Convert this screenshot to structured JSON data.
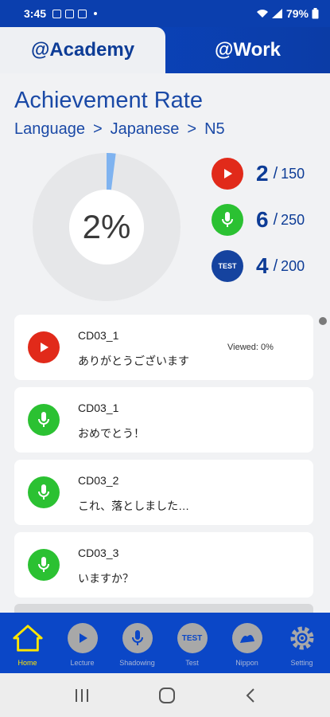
{
  "status_bar": {
    "time": "3:45",
    "battery": "79%"
  },
  "tabs": [
    {
      "label": "@Academy",
      "active": true
    },
    {
      "label": "@Work",
      "active": false
    }
  ],
  "header": {
    "title": "Achievement Rate",
    "breadcrumb": [
      "Language",
      "Japanese",
      "N5"
    ],
    "separator": ">"
  },
  "progress": {
    "percent_label": "2%",
    "value": 0.02
  },
  "stats": [
    {
      "icon": "play-icon",
      "value": "2",
      "total": "150",
      "color": "#e12a1a"
    },
    {
      "icon": "mic-icon",
      "value": "6",
      "total": "250",
      "color": "#2bc132"
    },
    {
      "icon": "test-icon",
      "icon_text": "TEST",
      "value": "4",
      "total": "200",
      "color": "#15439f"
    }
  ],
  "lessons": [
    {
      "type": "lecture",
      "code": "CD03_1",
      "phrase": "ありがとうございます",
      "viewed": "Viewed: 0%"
    },
    {
      "type": "shadowing",
      "code": "CD03_1",
      "phrase": "おめでとう！"
    },
    {
      "type": "shadowing",
      "code": "CD03_2",
      "phrase": "これ、落としました…"
    },
    {
      "type": "shadowing",
      "code": "CD03_3",
      "phrase": "いますか？"
    }
  ],
  "bottom_nav": [
    {
      "label": "Home",
      "active": true
    },
    {
      "label": "Lecture"
    },
    {
      "label": "Shadowing"
    },
    {
      "label": "Test",
      "icon_text": "TEST"
    },
    {
      "label": "Nippon"
    },
    {
      "label": "Setting"
    }
  ],
  "colors": {
    "brand_blue": "#0b47c7",
    "title_blue": "#1a49a6",
    "active_yellow": "#ffe600",
    "progress_blue": "#7fb3f0"
  }
}
